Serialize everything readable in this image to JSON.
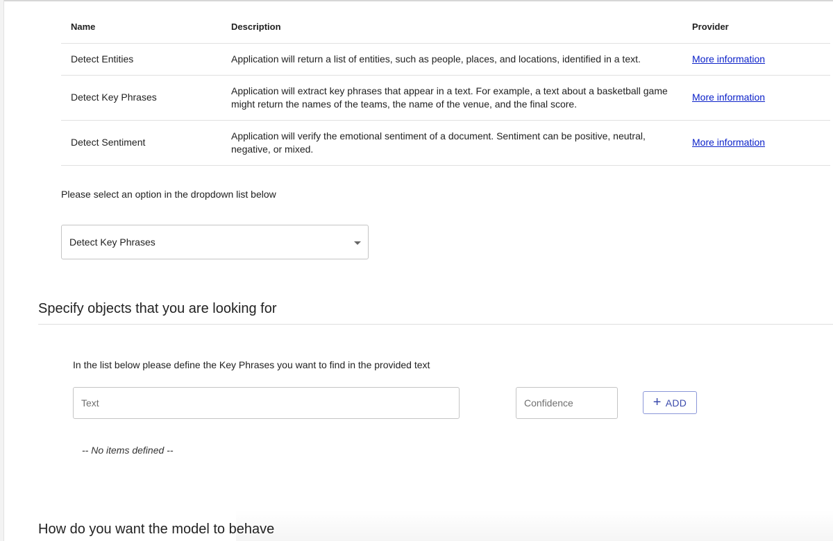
{
  "table": {
    "headers": {
      "name": "Name",
      "description": "Description",
      "provider": "Provider"
    },
    "rows": [
      {
        "name": "Detect Entities",
        "description": "Application will return a list of entities, such as people, places, and locations, identified in a text.",
        "link": "More information"
      },
      {
        "name": "Detect Key Phrases",
        "description": "Application will extract key phrases that appear in a text. For example, a text about a basketball game might return the names of the teams, the name of the venue, and the final score.",
        "link": "More information"
      },
      {
        "name": "Detect Sentiment",
        "description": "Application will verify the emotional sentiment of a document. Sentiment can be positive, neutral, negative, or mixed.",
        "link": "More information"
      }
    ]
  },
  "select": {
    "hint": "Please select an option in the dropdown list below",
    "selected": "Detect Key Phrases"
  },
  "objects_section": {
    "title": "Specify objects that you are looking for",
    "hint": "In the list below please define the Key Phrases you want to find in the provided text",
    "text_placeholder": "Text",
    "confidence_placeholder": "Confidence",
    "add_icon": "+",
    "add_label": "ADD",
    "empty_message": "-- No items defined --"
  },
  "behavior_section": {
    "title": "How do you want the model to behave"
  },
  "colors": {
    "link": "#0b21c9",
    "accent": "#3949ab",
    "border": "#c4c4c4"
  }
}
